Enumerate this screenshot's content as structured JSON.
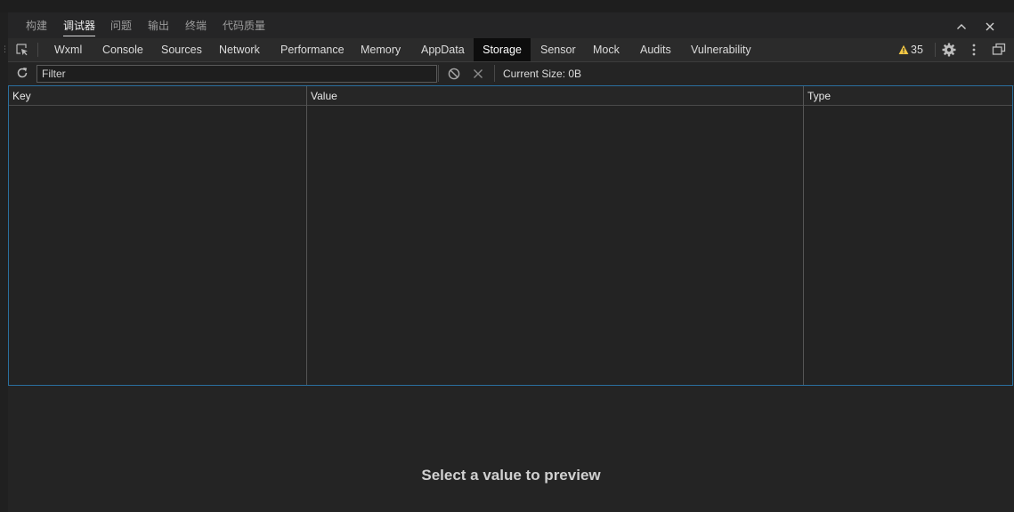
{
  "panel_tabs": [
    {
      "label": "构建",
      "active": false
    },
    {
      "label": "调试器",
      "active": true
    },
    {
      "label": "问题",
      "active": false
    },
    {
      "label": "输出",
      "active": false
    },
    {
      "label": "终端",
      "active": false
    },
    {
      "label": "代码质量",
      "active": false
    }
  ],
  "devtools_tabs": [
    {
      "label": "Wxml"
    },
    {
      "label": "Console"
    },
    {
      "label": "Sources"
    },
    {
      "label": "Network"
    },
    {
      "label": "Performance"
    },
    {
      "label": "Memory"
    },
    {
      "label": "AppData"
    },
    {
      "label": "Storage",
      "active": true
    },
    {
      "label": "Sensor"
    },
    {
      "label": "Mock"
    },
    {
      "label": "Audits"
    },
    {
      "label": "Vulnerability"
    }
  ],
  "warnings": {
    "count": "35",
    "icon": "warning-icon",
    "color": "#f2c744"
  },
  "filter": {
    "placeholder": "Filter",
    "value": ""
  },
  "storage": {
    "current_size": "Current Size: 0B"
  },
  "table": {
    "columns": [
      "Key",
      "Value",
      "Type"
    ],
    "rows": []
  },
  "preview": {
    "message": "Select a value to preview"
  },
  "icons": {
    "inspect": "inspect-element-icon",
    "refresh": "refresh-icon",
    "clear": "clear-all-icon",
    "delete": "delete-selected-icon",
    "settings": "gear-icon",
    "more": "more-vertical-icon",
    "undock": "dock-side-icon",
    "collapse": "chevron-up-icon",
    "close": "close-icon"
  },
  "colors": {
    "accent_border": "#2a6f9e",
    "active_tab_bg": "#0d0d0d"
  }
}
